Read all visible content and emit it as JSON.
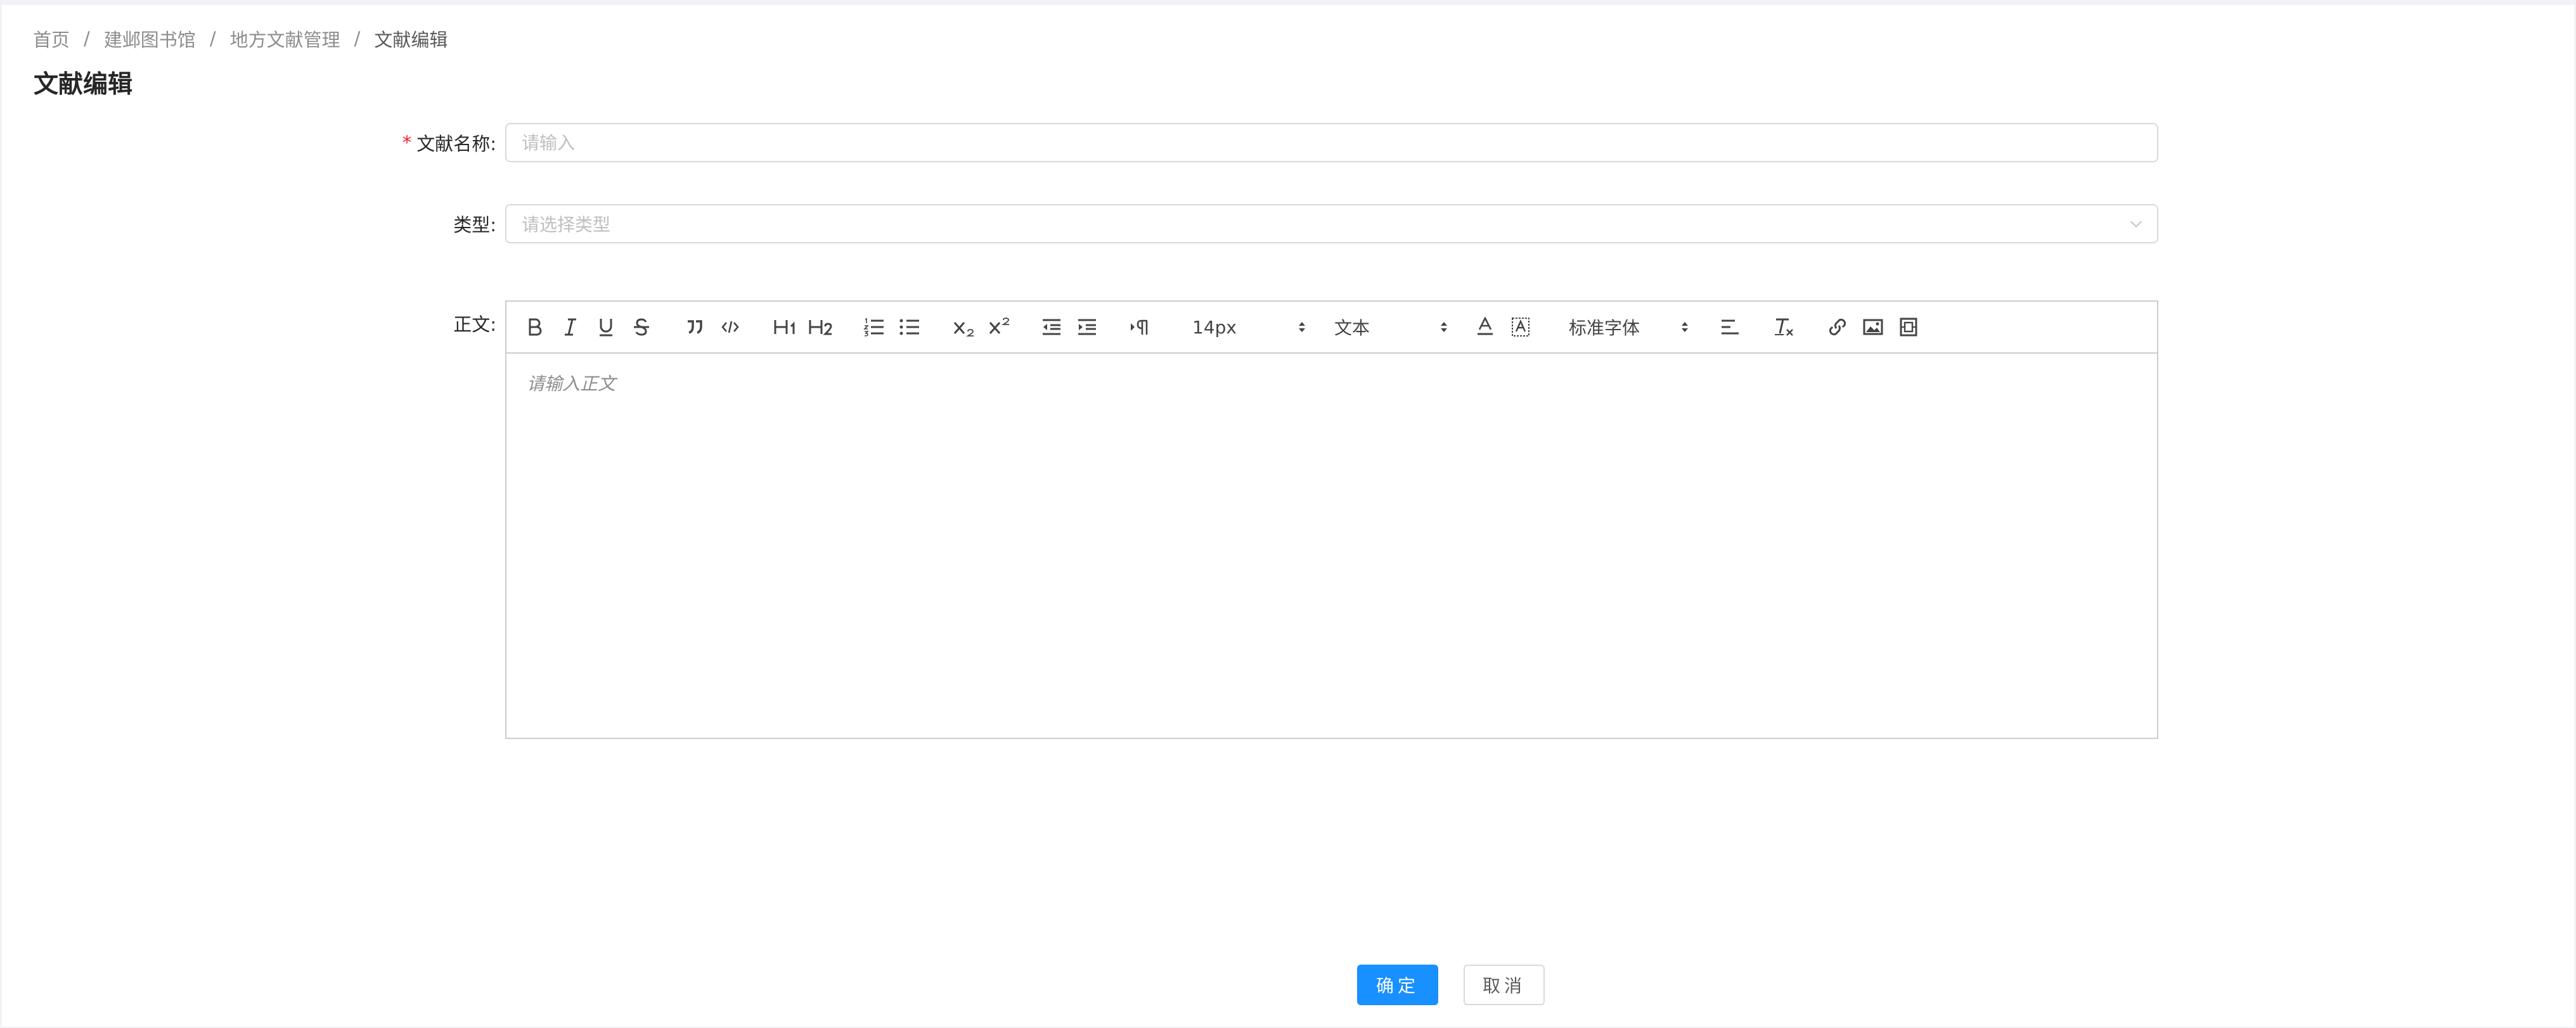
{
  "breadcrumb": {
    "items": [
      "首页",
      "建邺图书馆",
      "地方文献管理"
    ],
    "current": "文献编辑",
    "separator": "/"
  },
  "page_title": "文献编辑",
  "form": {
    "name": {
      "label": "文献名称:",
      "required_mark": "*",
      "placeholder": "请输入",
      "value": ""
    },
    "type": {
      "label": "类型:",
      "placeholder": "请选择类型",
      "arrow_icon": "chevron-down-icon"
    },
    "body": {
      "label": "正文:",
      "placeholder": "请输入正文",
      "toolbar": {
        "tools": [
          "bold-icon",
          "italic-icon",
          "underline-icon",
          "strike-icon",
          "blockquote-icon",
          "code-block-icon",
          "header-1-icon",
          "header-2-icon",
          "ordered-list-icon",
          "bullet-list-icon",
          "subscript-icon",
          "superscript-icon",
          "outdent-icon",
          "indent-icon",
          "text-direction-icon",
          "color-icon",
          "background-icon",
          "align-icon",
          "clean-format-icon",
          "link-icon",
          "image-icon",
          "video-icon"
        ],
        "size": "14px",
        "header": "文本",
        "font": "标准字体"
      }
    }
  },
  "actions": {
    "confirm": "确定",
    "cancel": "取消"
  },
  "colors": {
    "primary": "#1890ff",
    "required": "#f5222d",
    "border": "#d9d9d9"
  }
}
